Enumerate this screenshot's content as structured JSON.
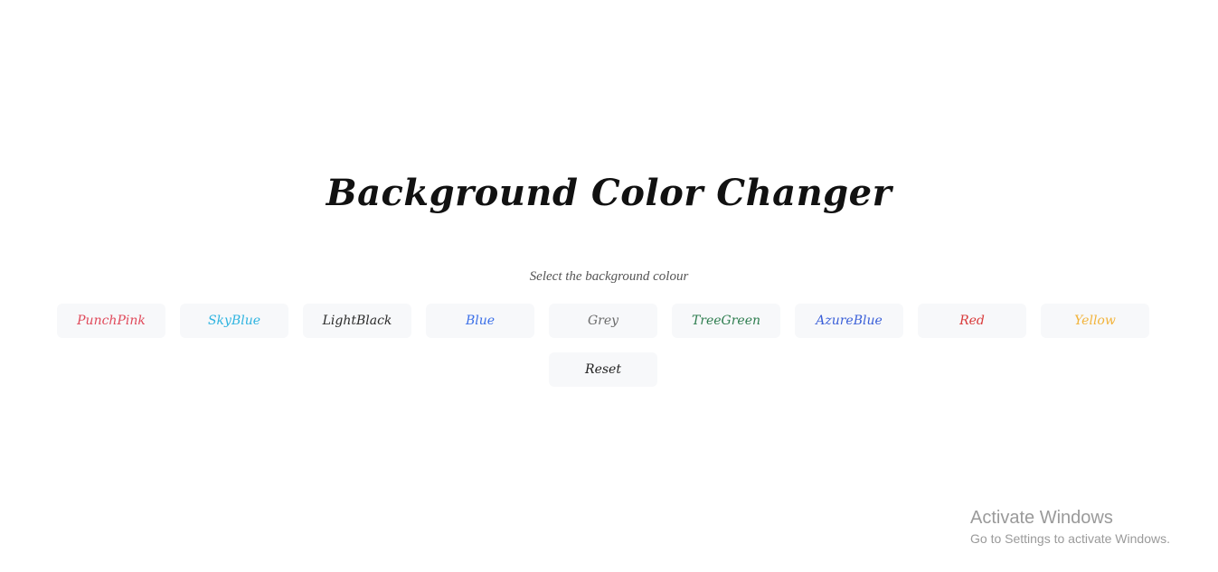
{
  "title": "Background Color Changer",
  "subtitle": "Select the background colour",
  "buttons": [
    {
      "label": "PunchPink",
      "color": "#e04a5b"
    },
    {
      "label": "SkyBlue",
      "color": "#2fb4e0"
    },
    {
      "label": "LightBlack",
      "color": "#2b2b2b"
    },
    {
      "label": "Blue",
      "color": "#3b6fe8"
    },
    {
      "label": "Grey",
      "color": "#6b6b6b"
    },
    {
      "label": "TreeGreen",
      "color": "#2e7d4f"
    },
    {
      "label": "AzureBlue",
      "color": "#3a5fd8"
    },
    {
      "label": "Red",
      "color": "#d93a3a"
    },
    {
      "label": "Yellow",
      "color": "#f2b33a"
    }
  ],
  "reset": {
    "label": "Reset",
    "color": "#222222"
  },
  "watermark": {
    "title": "Activate Windows",
    "subtitle": "Go to Settings to activate Windows."
  }
}
